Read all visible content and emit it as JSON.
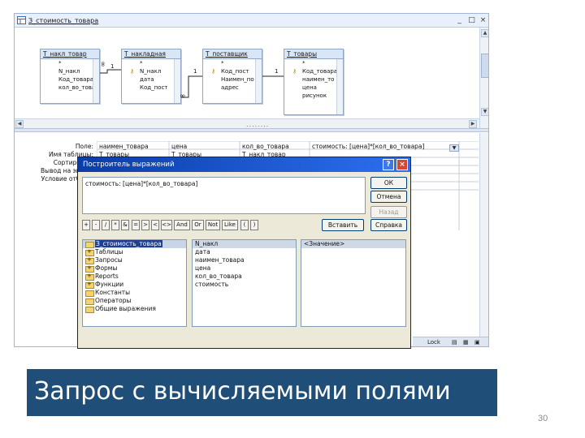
{
  "window": {
    "title": "З_стоимость_товара",
    "controls": [
      "_",
      "□",
      "×"
    ]
  },
  "tables": [
    {
      "name": "Т_накл_товар",
      "fields": [
        "*",
        "N_накл",
        "Код_товара",
        "кол_во_товар"
      ],
      "key": []
    },
    {
      "name": "Т_накладная",
      "fields": [
        "*",
        "N_накл",
        "дата",
        "Код_пост"
      ],
      "key": [
        1
      ]
    },
    {
      "name": "Т_поставщик",
      "fields": [
        "*",
        "Код_пост",
        "Наимен_по",
        "адрес"
      ],
      "key": [
        1
      ]
    },
    {
      "name": "Т_товары",
      "fields": [
        "*",
        "Код_товара",
        "наимен_то",
        "цена",
        "рисунок"
      ],
      "key": [
        1
      ]
    }
  ],
  "relations": {
    "one": "1",
    "many": "∞"
  },
  "grid": {
    "row_labels": [
      "Поле:",
      "Имя таблицы:",
      "Сортировка:",
      "Вывод на экран:",
      "Условие отбора:"
    ],
    "columns": [
      {
        "field": "наимен_товара",
        "table": "Т_товары"
      },
      {
        "field": "цена",
        "table": "Т_товары"
      },
      {
        "field": "кол_во_товара",
        "table": "Т_накл_товар"
      },
      {
        "field": "стоимость: [цена]*[кол_во_товара]",
        "table": ""
      }
    ]
  },
  "dialog": {
    "title": "Построитель выражений",
    "help": "?",
    "close": "×",
    "expression": "стоимость: [цена]*[кол_во_товара]",
    "buttons": {
      "ok": "ОК",
      "cancel": "Отмена",
      "back": "Назад",
      "help": "Справка",
      "insert": "Вставить"
    },
    "operators": [
      "+",
      "-",
      "/",
      "*",
      "&",
      "=",
      ">",
      "<",
      "<>",
      "And",
      "Or",
      "Not",
      "Like",
      "(",
      ")"
    ],
    "folders": [
      {
        "label": "З_стоимость_товара",
        "plus": false,
        "highlight": true
      },
      {
        "label": "Таблицы",
        "plus": true,
        "highlight": false
      },
      {
        "label": "Запросы",
        "plus": true,
        "highlight": false
      },
      {
        "label": "Формы",
        "plus": true,
        "highlight": false
      },
      {
        "label": "Reports",
        "plus": true,
        "highlight": false
      },
      {
        "label": "Функции",
        "plus": true,
        "highlight": false
      },
      {
        "label": "Константы",
        "plus": false,
        "highlight": false
      },
      {
        "label": "Операторы",
        "plus": false,
        "highlight": false
      },
      {
        "label": "Общие выражения",
        "plus": false,
        "highlight": false
      }
    ],
    "fields": [
      "N_накл",
      "дата",
      "наимен_товара",
      "цена",
      "кол_во_товара",
      "стоимость"
    ],
    "values": [
      "<Значение>"
    ]
  },
  "statusbar": {
    "left": "Lock",
    "icons": [
      "▤",
      "▦",
      "▣"
    ]
  },
  "caption": "Запрос с вычисляемыми полями",
  "page_number": "30"
}
